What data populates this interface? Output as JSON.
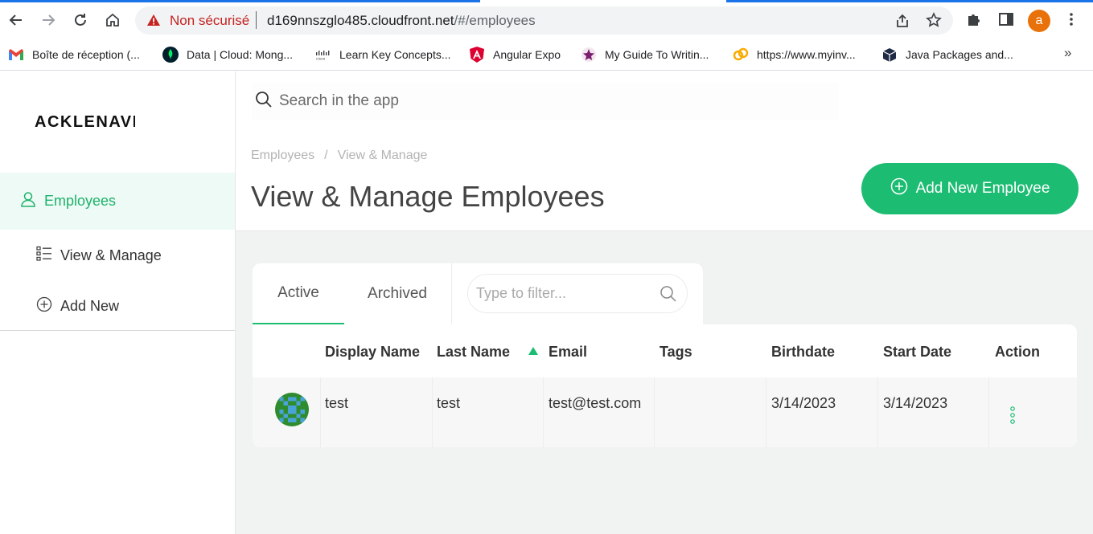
{
  "browser": {
    "security_label": "Non sécurisé",
    "url_host": "d169nnszglo485.cloudfront.net",
    "url_path": "/#/employees",
    "profile_initial": "a",
    "accent_color": "#1a73e8",
    "bookmarks": [
      {
        "label": "Boîte de réception (...",
        "icon": "gmail-icon"
      },
      {
        "label": "Data | Cloud: Mong...",
        "icon": "mongodb-icon"
      },
      {
        "label": "Learn Key Concepts...",
        "icon": "cisco-icon"
      },
      {
        "label": "Angular Expo",
        "icon": "angular-icon"
      },
      {
        "label": "My Guide To Writin...",
        "icon": "star-badge-icon"
      },
      {
        "label": "https://www.myinv...",
        "icon": "link-icon"
      },
      {
        "label": "Java Packages and...",
        "icon": "package-icon"
      }
    ],
    "more_label": "»"
  },
  "app": {
    "logo_text": "ACKLENAVENUE",
    "brand_color": "#1cbc73",
    "sidebar": {
      "main_item": "Employees",
      "sub_items": [
        {
          "label": "View & Manage",
          "icon": "list-icon"
        },
        {
          "label": "Add New",
          "icon": "plus-circle-icon"
        }
      ]
    },
    "search_placeholder": "Search in the app",
    "breadcrumb": [
      "Employees",
      "View & Manage"
    ],
    "breadcrumb_sep": "/",
    "page_title": "View & Manage Employees",
    "add_button_label": "Add New Employee",
    "tabs": [
      "Active",
      "Archived"
    ],
    "filter_placeholder": "Type to filter...",
    "table": {
      "columns": [
        "Display Name",
        "Last Name",
        "Email",
        "Tags",
        "Birthdate",
        "Start Date",
        "Action"
      ],
      "rows": [
        {
          "display_name": "test",
          "last_name": "test",
          "email": "test@test.com",
          "tags": "",
          "birthdate": "3/14/2023",
          "start_date": "3/14/2023"
        }
      ]
    }
  }
}
